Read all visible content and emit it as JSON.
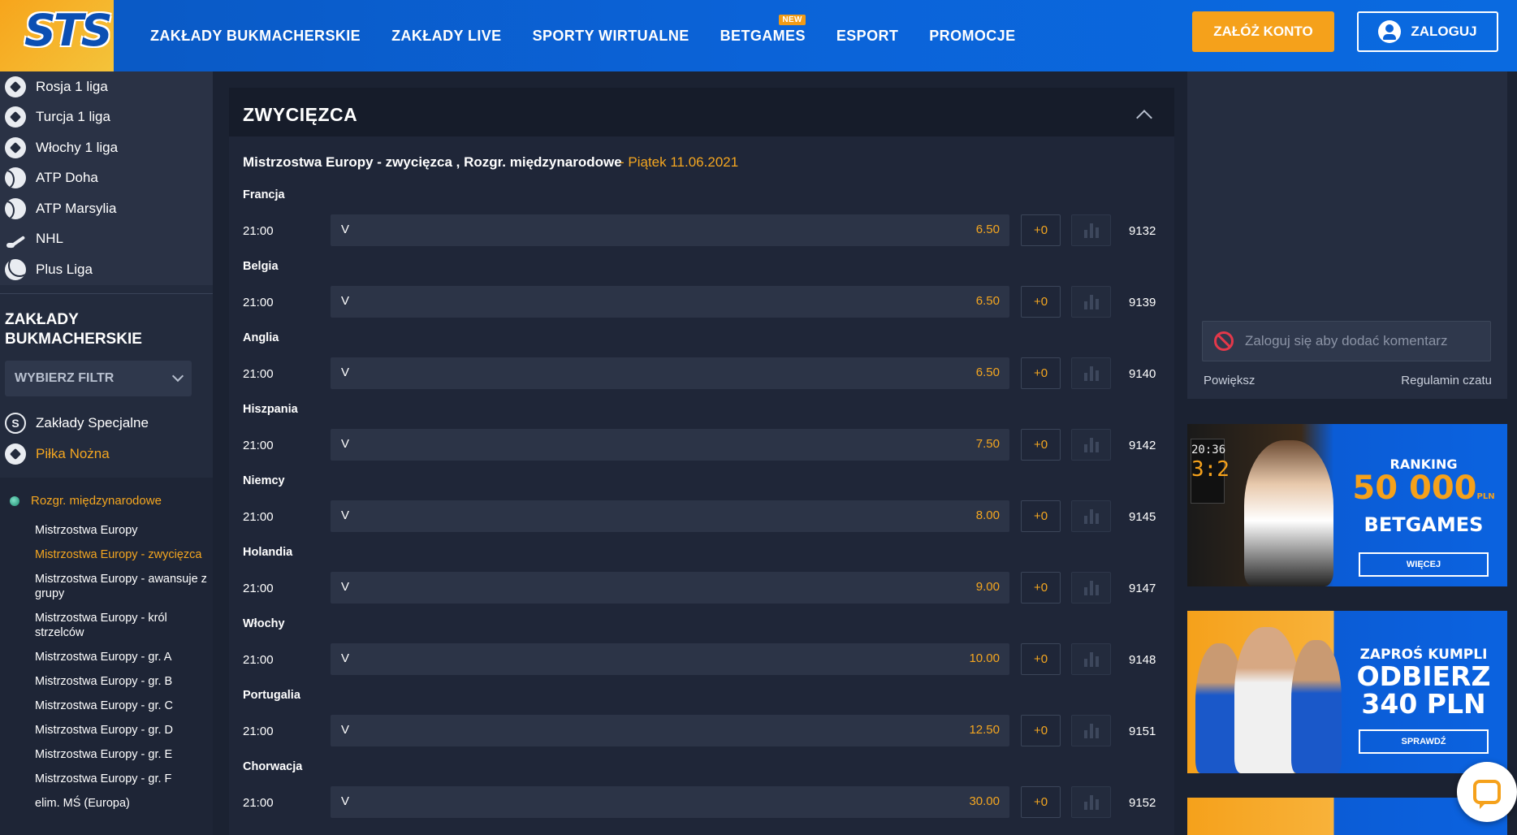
{
  "header": {
    "logo": "STS",
    "nav": [
      {
        "label": "ZAKŁADY BUKMACHERSKIE"
      },
      {
        "label": "ZAKŁADY LIVE"
      },
      {
        "label": "SPORTY WIRTUALNE"
      },
      {
        "label": "BETGAMES",
        "badge": "NEW"
      },
      {
        "label": "ESPORT"
      },
      {
        "label": "PROMOCJE"
      }
    ],
    "register_label": "ZAŁÓŻ KONTO",
    "login_label": "ZALOGUJ"
  },
  "sidebar": {
    "leagues": [
      {
        "label": "Rosja 1 liga",
        "icon": "soccer-ball-icon"
      },
      {
        "label": "Turcja 1 liga",
        "icon": "soccer-ball-icon"
      },
      {
        "label": "Włochy 1 liga",
        "icon": "soccer-ball-icon"
      },
      {
        "label": "ATP Doha",
        "icon": "tennis-ball-icon"
      },
      {
        "label": "ATP Marsylia",
        "icon": "tennis-ball-icon"
      },
      {
        "label": "NHL",
        "icon": "hockey-stick-icon"
      },
      {
        "label": "Plus Liga",
        "icon": "volleyball-icon"
      }
    ],
    "section_title": "ZAKŁADY BUKMACHERSKIE",
    "filter_label": "WYBIERZ FILTR",
    "sports": [
      {
        "label": "Zakłady Specjalne",
        "icon": "special-bets-icon",
        "icon_glyph": "S"
      },
      {
        "label": "Piłka Nożna",
        "icon": "soccer-ball-icon"
      }
    ],
    "category": "Rozgr. międzynarodowe",
    "items": [
      {
        "label": "Mistrzostwa Europy"
      },
      {
        "label": "Mistrzostwa Europy - zwycięzca",
        "active": true
      },
      {
        "label": "Mistrzostwa Europy - awansuje z grupy"
      },
      {
        "label": "Mistrzostwa Europy - król strzelców"
      },
      {
        "label": "Mistrzostwa Europy - gr. A"
      },
      {
        "label": "Mistrzostwa Europy - gr. B"
      },
      {
        "label": "Mistrzostwa Europy - gr. C"
      },
      {
        "label": "Mistrzostwa Europy - gr. D"
      },
      {
        "label": "Mistrzostwa Europy - gr. E"
      },
      {
        "label": "Mistrzostwa Europy - gr. F"
      },
      {
        "label": "elim. MŚ (Europa)"
      }
    ]
  },
  "main": {
    "panel_title": "ZWYCIĘZCA",
    "event_title": "Mistrzostwa Europy - zwycięzca , Rozgr. międzynarodowe",
    "event_date": "- Piątek 11.06.2021",
    "rows": [
      {
        "team": "Francja",
        "time": "21:00",
        "label": "V",
        "odd": "6.50",
        "plus": "+0",
        "code": "9132"
      },
      {
        "team": "Belgia",
        "time": "21:00",
        "label": "V",
        "odd": "6.50",
        "plus": "+0",
        "code": "9139"
      },
      {
        "team": "Anglia",
        "time": "21:00",
        "label": "V",
        "odd": "6.50",
        "plus": "+0",
        "code": "9140"
      },
      {
        "team": "Hiszpania",
        "time": "21:00",
        "label": "V",
        "odd": "7.50",
        "plus": "+0",
        "code": "9142"
      },
      {
        "team": "Niemcy",
        "time": "21:00",
        "label": "V",
        "odd": "8.00",
        "plus": "+0",
        "code": "9145"
      },
      {
        "team": "Holandia",
        "time": "21:00",
        "label": "V",
        "odd": "9.00",
        "plus": "+0",
        "code": "9147"
      },
      {
        "team": "Włochy",
        "time": "21:00",
        "label": "V",
        "odd": "10.00",
        "plus": "+0",
        "code": "9148"
      },
      {
        "team": "Portugalia",
        "time": "21:00",
        "label": "V",
        "odd": "12.50",
        "plus": "+0",
        "code": "9151"
      },
      {
        "team": "Chorwacja",
        "time": "21:00",
        "label": "V",
        "odd": "30.00",
        "plus": "+0",
        "code": "9152"
      }
    ]
  },
  "chat": {
    "placeholder": "Zaloguj się aby dodać komentarz",
    "enlarge_label": "Powiększ",
    "rules_label": "Regulamin czatu"
  },
  "banners": {
    "b1": {
      "line1": "RANKING",
      "big": "50 000",
      "currency": "PLN",
      "line3": "BETGAMES",
      "button": "WIĘCEJ",
      "clock": "20:36",
      "score": "3:2"
    },
    "b2": {
      "line1": "ZAPROŚ KUMPLI",
      "line2": "ODBIERZ",
      "line3": "340 PLN",
      "button": "SPRAWDŹ"
    }
  },
  "colors": {
    "accent": "#f4a620",
    "header_blue": "#0b63d8",
    "bg": "#1b2232"
  }
}
